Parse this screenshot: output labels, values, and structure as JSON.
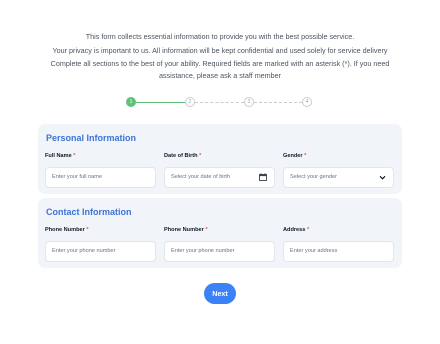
{
  "intro": {
    "line1": "This form collects essential information to provide you with the best possible service.",
    "line2": "Your privacy is important to us. All information will be kept confidential and used solely for service delivery",
    "line3": "Complete all sections to the best of your ability. Required fields are marked with an asterisk (*). If you need",
    "line4": "assistance, please ask a staff member"
  },
  "stepper": {
    "steps": [
      "1",
      "2",
      "3",
      "4"
    ],
    "current": 1
  },
  "personal": {
    "title": "Personal Information",
    "full_name": {
      "label": "Full Name",
      "required": "*",
      "placeholder": "Enter your full name"
    },
    "dob": {
      "label": "Date of Birth",
      "required": "*",
      "placeholder": "Select your date of birth",
      "icon": "calendar-icon"
    },
    "gender": {
      "label": "Gender",
      "required": "*",
      "placeholder": "Select your gender",
      "icon": "chevron-down-icon"
    }
  },
  "contact": {
    "title": "Contact Information",
    "phone1": {
      "label": "Phone Number",
      "required": "*",
      "placeholder": "Enter your phone number"
    },
    "phone2": {
      "label": "Phone Number",
      "required": "*",
      "placeholder": "Enter your phone number"
    },
    "address": {
      "label": "Address",
      "required": "*",
      "placeholder": "Enter your address"
    }
  },
  "actions": {
    "next_label": "Next"
  },
  "colors": {
    "accent": "#3b82f6",
    "success": "#5ec27b",
    "title": "#3b74d9",
    "required": "#e05252"
  }
}
